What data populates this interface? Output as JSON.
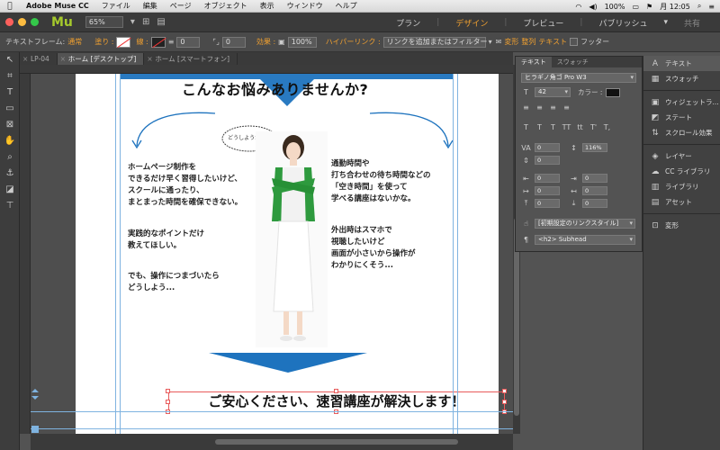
{
  "menubar": {
    "apple": "",
    "items": [
      "Adobe Muse CC",
      "ファイル",
      "編集",
      "ページ",
      "オブジェクト",
      "表示",
      "ウィンドウ",
      "ヘルプ"
    ],
    "battery": "100%",
    "clock": "月 12:05"
  },
  "appbar": {
    "logo": "Mu",
    "zoom": "65%",
    "modes": {
      "plan": "プラン",
      "design": "デザイン",
      "preview": "プレビュー",
      "publish": "パブリッシュ",
      "share": "共有"
    }
  },
  "controlbar": {
    "frame_label": "テキストフレーム:",
    "frame_value": "通常",
    "fill_label": "塗り :",
    "stroke_label": "線 :",
    "stroke_value": "0",
    "padding_value": "0",
    "effect_label": "効果 :",
    "opacity": "100%",
    "hyperlink_label": "ハイパーリンク :",
    "hyperlink_value": "リンクを追加またはフィルター",
    "transform": "変形",
    "align": "整列",
    "text": "テキスト",
    "footer": "フッター"
  },
  "tabs": [
    {
      "label": "LP-04",
      "active": false
    },
    {
      "label": "ホーム [デスクトップ]",
      "active": true
    },
    {
      "label": "ホーム [スマートフォン]",
      "active": false
    }
  ],
  "page": {
    "heading": "こんなお悩みありませんか?",
    "bubble": "どうしようかな...",
    "left_block1": [
      "ホームページ制作を",
      "できるだけ早く習得したいけど、",
      "スクールに通ったり、",
      "まとまった時間を確保できない。"
    ],
    "left_block2": [
      "実践的なポイントだけ",
      "教えてほしい。"
    ],
    "left_block3": [
      "でも、操作につまづいたら",
      "どうしよう..."
    ],
    "right_block1": [
      "通勤時間や",
      "打ち合わせの待ち時間などの",
      "「空き時間」を使って",
      "学べる講座はないかな。"
    ],
    "right_block2": [
      "外出時はスマホで",
      "視聴したいけど",
      "画面が小さいから操作が",
      "わかりにくそう..."
    ],
    "bottom_heading": "ご安心ください、速習講座が解決します！"
  },
  "text_panel": {
    "tab_text": "テキスト",
    "tab_swatch": "スウォッチ",
    "font": "ヒラギノ角ゴ Pro W3",
    "size": "42",
    "color_label": "カラー :",
    "spacing1": "0",
    "leading": "116%",
    "spacing2": "0",
    "indent1": "0",
    "indent2": "0",
    "indent3": "0",
    "indent4": "0",
    "indent5": "0",
    "indent6": "0",
    "link_style": "[初期設定のリンクスタイル]",
    "para_style": "<h2> Subhead"
  },
  "dock": {
    "items": [
      "テキスト",
      "スウォッチ",
      "ウィジェットラ...",
      "ステート",
      "スクロール効果",
      "レイヤー",
      "CC ライブラリ",
      "ライブラリ",
      "アセット",
      "変形"
    ]
  },
  "colors": {
    "accent": "#f0a030",
    "arrow_blue": "#1e73be",
    "guide": "#7fb3e0",
    "selection": "#e85a5a",
    "mu_green": "#a5c92c"
  }
}
